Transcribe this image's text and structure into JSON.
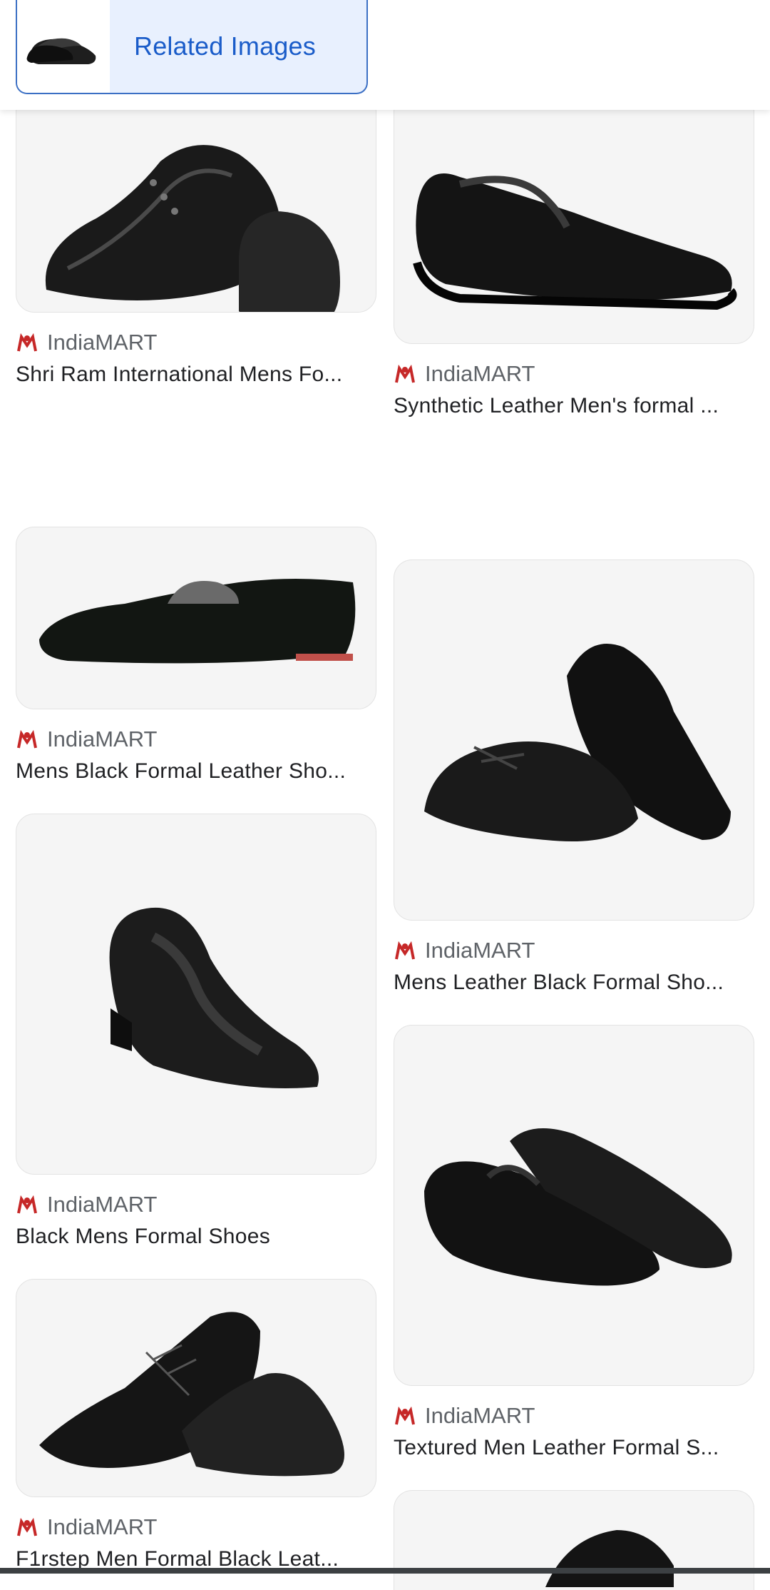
{
  "header": {
    "related_label": "Related Images",
    "thumb_icon": "shoe-thumbnail"
  },
  "results": [
    {
      "source": "IndiaMART",
      "title": "Shri Ram International Mens Fo..."
    },
    {
      "source": "IndiaMART",
      "title": "Synthetic Leather Men's formal ..."
    },
    {
      "source": "IndiaMART",
      "title": "Mens Black Formal Leather Sho..."
    },
    {
      "source": "IndiaMART",
      "title": "Mens Leather Black Formal Sho..."
    },
    {
      "source": "IndiaMART",
      "title": "Black Mens Formal Shoes"
    },
    {
      "source": "IndiaMART",
      "title": "Textured Men Leather Formal S..."
    },
    {
      "source": "IndiaMART",
      "title": "F1rstep Men Formal Black Leat..."
    }
  ],
  "colors": {
    "accent": "#1a5cc9",
    "chip_bg": "#e8f0fe",
    "source_logo": "#c62828"
  }
}
